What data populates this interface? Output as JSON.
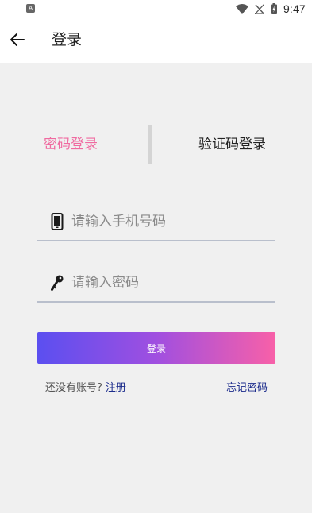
{
  "status_bar": {
    "time": "9:47",
    "left_icon_letter": "A",
    "icons": [
      "wifi-icon",
      "signal-icon",
      "battery-icon"
    ]
  },
  "app_bar": {
    "title": "登录",
    "back_icon": "arrow-left-icon"
  },
  "tabs": [
    {
      "label": "密码登录",
      "active": true
    },
    {
      "label": "验证码登录",
      "active": false
    }
  ],
  "form": {
    "phone": {
      "icon": "phone-icon",
      "placeholder": "请输入手机号码",
      "value": ""
    },
    "password": {
      "icon": "key-icon",
      "placeholder": "请输入密码",
      "value": ""
    },
    "login_label": "登录"
  },
  "footer": {
    "no_account": "还没有账号?",
    "register": "注册",
    "forgot": "忘记密码"
  },
  "colors": {
    "accent": "#f06aa0",
    "link": "#1c2c8c",
    "gradient_start": "#5b4ff0",
    "gradient_end": "#f860a8"
  }
}
